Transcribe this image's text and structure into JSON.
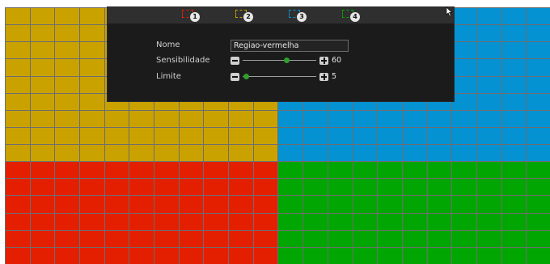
{
  "grid": {
    "cols": 22,
    "rows": 15,
    "regions": [
      {
        "id": 1,
        "color": "#e41f00"
      },
      {
        "id": 2,
        "color": "#c9a200"
      },
      {
        "id": 3,
        "color": "#0492d3"
      },
      {
        "id": 4,
        "color": "#02a602"
      }
    ]
  },
  "region_tabs": [
    {
      "number": "1",
      "color": "#e41f00"
    },
    {
      "number": "2",
      "color": "#c9a200"
    },
    {
      "number": "3",
      "color": "#0492d3"
    },
    {
      "number": "4",
      "color": "#02a602"
    }
  ],
  "settings": {
    "name_label": "Nome",
    "name_value": "Regiao-vermelha",
    "sensitivity_label": "Sensibilidade",
    "sensitivity_value": "60",
    "sensitivity_level": 60,
    "limit_label": "Limite",
    "limit_value": "5",
    "limit_level": 5
  },
  "colors": {
    "panel_bg": "#1b1b1b",
    "slider_thumb": "#2ea02e"
  }
}
